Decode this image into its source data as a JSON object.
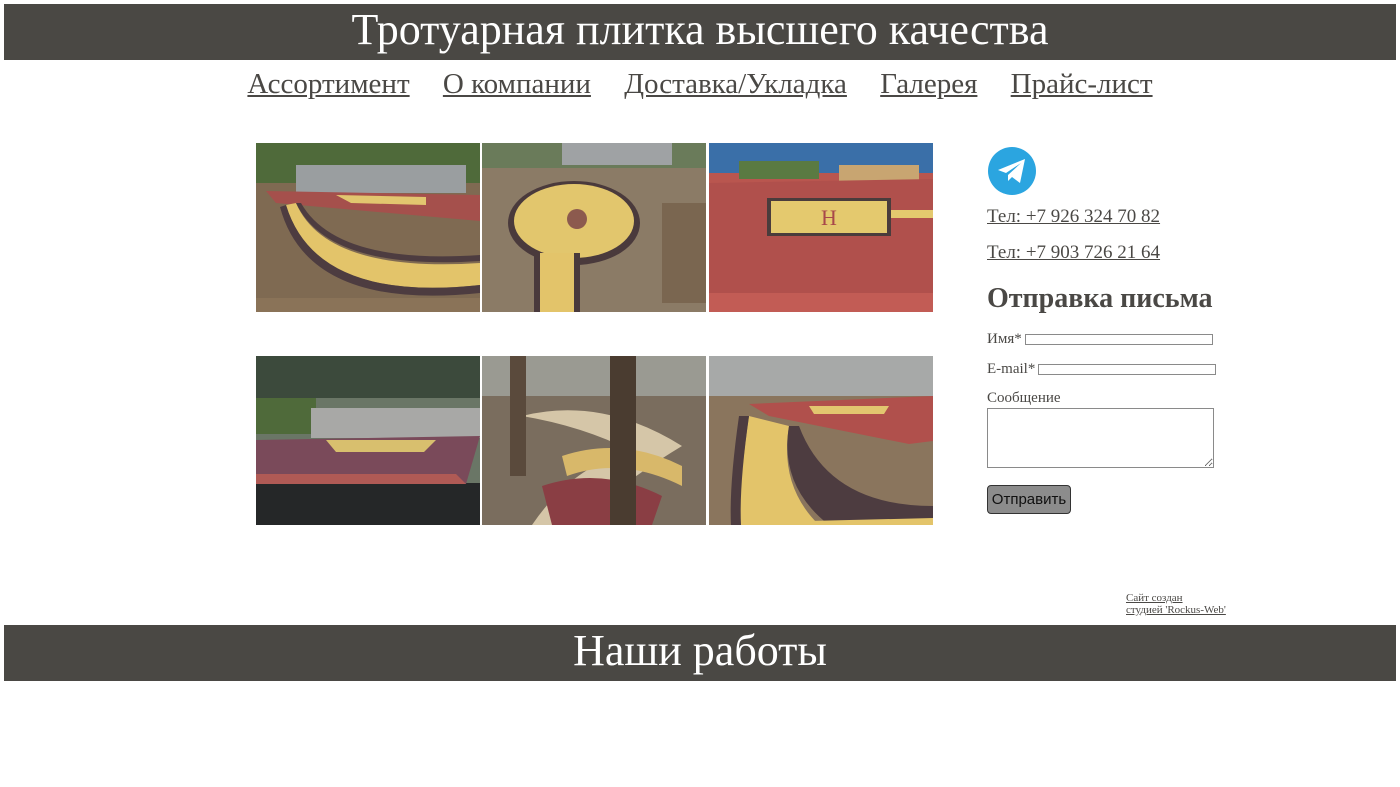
{
  "header": {
    "title": "Тротуарная плитка высшего качества"
  },
  "nav": {
    "items": [
      {
        "label": "Ассортимент"
      },
      {
        "label": "О компании"
      },
      {
        "label": "Доставка/Укладка"
      },
      {
        "label": "Галерея"
      },
      {
        "label": "Прайс-лист"
      }
    ]
  },
  "gallery": {
    "icon": "photo-tile"
  },
  "contacts": {
    "telegram_icon": "telegram-icon",
    "telegram_color": "#2ba5e0",
    "phone1": "Тел: +7 926 324 70 82",
    "phone2": "Тел: +7 903 726 21 64"
  },
  "form": {
    "title": "Отправка письма",
    "name_label": "Имя*",
    "email_label": "E-mail*",
    "message_label": "Сообщение",
    "submit_label": "Отправить"
  },
  "footer": {
    "credit_line1": "Сайт создан",
    "credit_line2": "студией 'Rockus-Web'"
  },
  "section": {
    "title": "Наши работы"
  },
  "colors": {
    "banner": "#4a4844",
    "text": "#4a4845",
    "paving_yellow": "#e3c46a",
    "paving_red": "#a8484a",
    "paving_dark": "#4a3c3c"
  }
}
